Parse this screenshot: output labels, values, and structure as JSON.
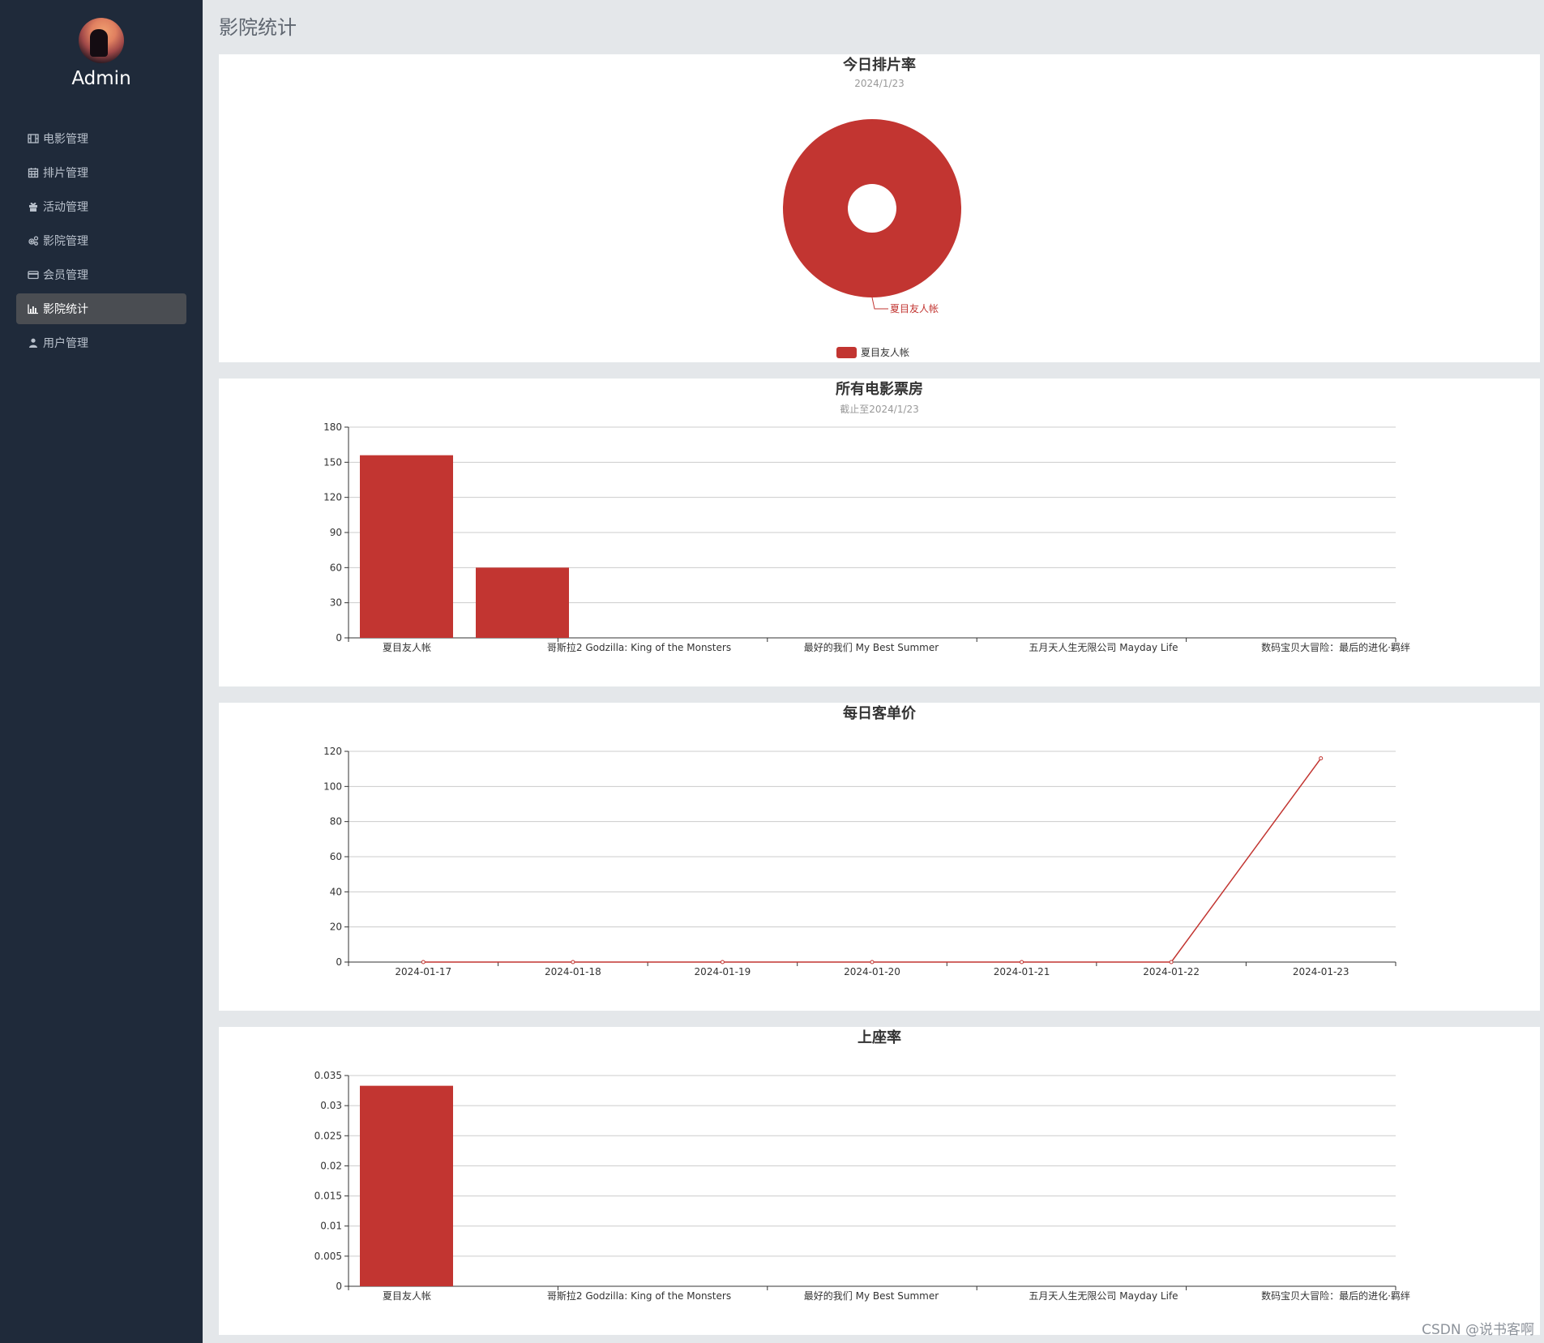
{
  "sidebar": {
    "user": "Admin",
    "items": [
      {
        "label": "电影管理",
        "icon": "film-icon",
        "active": false
      },
      {
        "label": "排片管理",
        "icon": "calendar-icon",
        "active": false
      },
      {
        "label": "活动管理",
        "icon": "gift-icon",
        "active": false
      },
      {
        "label": "影院管理",
        "icon": "cogs-icon",
        "active": false
      },
      {
        "label": "会员管理",
        "icon": "credit-card-icon",
        "active": false
      },
      {
        "label": "影院统计",
        "icon": "bar-chart-icon",
        "active": true
      },
      {
        "label": "用户管理",
        "icon": "user-icon",
        "active": false
      }
    ]
  },
  "page": {
    "title": "影院统计"
  },
  "colors": {
    "series": "#c23531",
    "sidebar": "#1f2a3a",
    "active_item": "#4a4d52"
  },
  "watermark": "CSDN @说书客啊",
  "chart_data": [
    {
      "type": "pie",
      "title": "今日排片率",
      "subtitle": "2024/1/23",
      "slices": [
        {
          "name": "夏目友人帐",
          "value": 1
        }
      ],
      "legend": [
        "夏目友人帐"
      ],
      "legend_position": "bottom-center",
      "donut": true
    },
    {
      "type": "bar",
      "title": "所有电影票房",
      "subtitle": "截止至2024/1/23",
      "categories": [
        "夏目友人帐",
        "哥斯拉2 Godzilla: King of the Monsters",
        "最好的我们 My Best Summer",
        "五月天人生无限公司 Mayday Life",
        "数码宝贝大冒险：最后的进化·羁绊"
      ],
      "values": [
        156,
        60,
        0,
        0,
        0
      ],
      "ylim": [
        0,
        180
      ],
      "yticks": [
        "0",
        "30",
        "60",
        "90",
        "120",
        "150",
        "180"
      ],
      "grid": true
    },
    {
      "type": "line",
      "title": "每日客单价",
      "subtitle": "",
      "categories": [
        "2024-01-17",
        "2024-01-18",
        "2024-01-19",
        "2024-01-20",
        "2024-01-21",
        "2024-01-22",
        "2024-01-23"
      ],
      "values": [
        0,
        0,
        0,
        0,
        0,
        0,
        116
      ],
      "ylim": [
        0,
        120
      ],
      "yticks": [
        "0",
        "20",
        "40",
        "60",
        "80",
        "100",
        "120"
      ],
      "grid": true
    },
    {
      "type": "bar",
      "title": "上座率",
      "subtitle": "",
      "categories": [
        "夏目友人帐",
        "哥斯拉2 Godzilla: King of the Monsters",
        "最好的我们 My Best Summer",
        "五月天人生无限公司 Mayday Life",
        "数码宝贝大冒险：最后的进化·羁绊"
      ],
      "values": [
        0.0333,
        0,
        0,
        0,
        0
      ],
      "ylim": [
        0,
        0.035
      ],
      "yticks": [
        "0",
        "0.005",
        "0.01",
        "0.015",
        "0.02",
        "0.025",
        "0.03",
        "0.035"
      ],
      "grid": true
    }
  ]
}
